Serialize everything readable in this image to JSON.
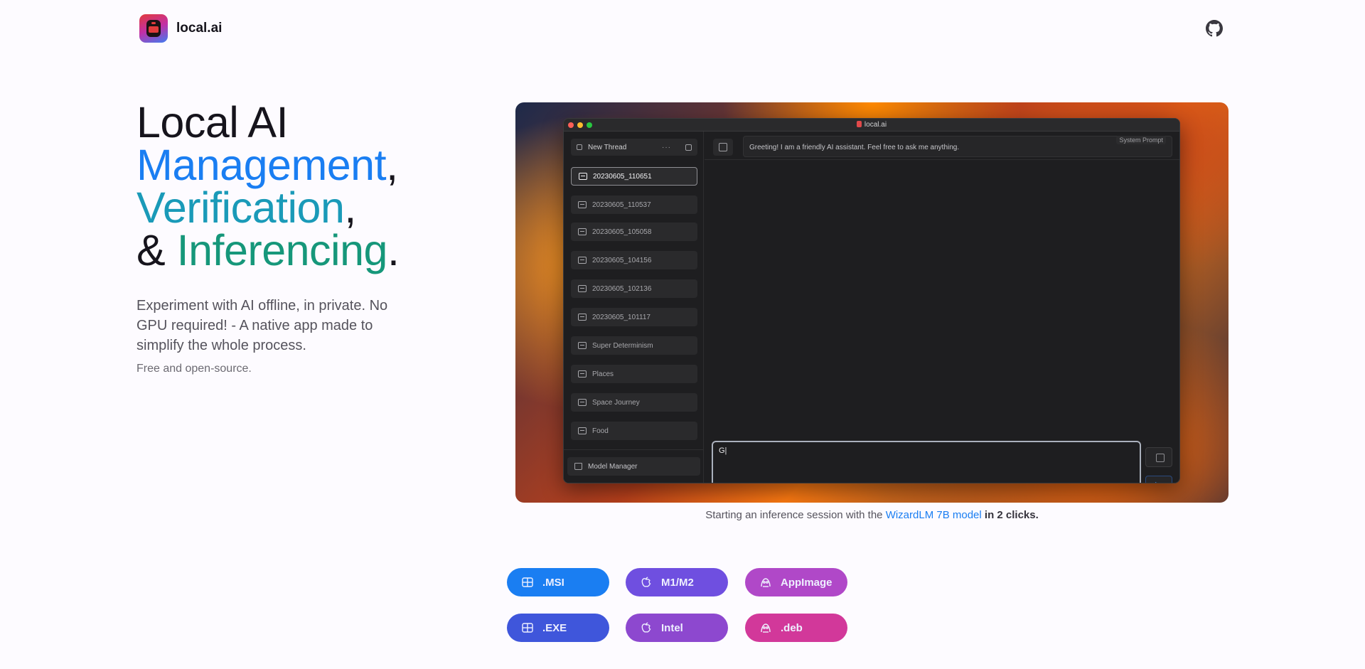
{
  "header": {
    "brand": "local.ai"
  },
  "hero": {
    "line1": "Local AI",
    "line2_word": "Management",
    "line2_punct": ",",
    "line3_word": "Verification",
    "line3_punct": ",",
    "line4_prefix": "& ",
    "line4_word": "Inferencing",
    "line4_punct": ".",
    "description": "Experiment with AI offline, in private. No GPU required! - A native app made to simplify the whole process.",
    "sub": "Free and open-source."
  },
  "app_window": {
    "title": "local.ai",
    "new_thread_label": "New Thread",
    "more_label": "···",
    "threads": [
      "20230605_110651",
      "20230605_110537",
      "20230605_105058",
      "20230605_104156",
      "20230605_102136",
      "20230605_101117",
      "Super Determinism",
      "Places",
      "Space Journey",
      "Food"
    ],
    "active_thread_index": 0,
    "model_manager_label": "Model Manager",
    "system_prompt_label": "System Prompt",
    "system_prompt_value": "Greeting! I am a friendly AI assistant. Feel free to ask me anything.",
    "compose_value": "G|"
  },
  "caption": {
    "prefix": "Starting an inference session with the",
    "link": "WizardLM 7B model",
    "suffix": "in 2 clicks."
  },
  "downloads": [
    {
      "label": ".MSI",
      "icon": "windows-icon",
      "color": "#1a7ef2"
    },
    {
      "label": "M1/M2",
      "icon": "apple-icon",
      "color": "#6f4fe0"
    },
    {
      "label": "AppImage",
      "icon": "linux-icon",
      "color": "#b048c8"
    },
    {
      "label": ".EXE",
      "icon": "windows-icon",
      "color": "#3f56db"
    },
    {
      "label": "Intel",
      "icon": "apple-icon",
      "color": "#8d48cf"
    },
    {
      "label": ".deb",
      "icon": "linux-icon",
      "color": "#d2389a"
    }
  ]
}
